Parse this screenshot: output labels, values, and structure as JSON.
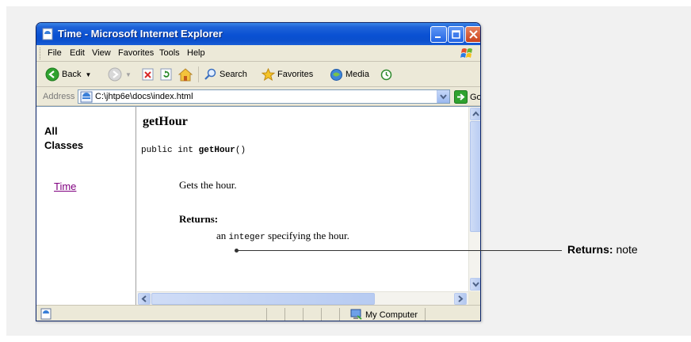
{
  "window": {
    "title": "Time - Microsoft Internet Explorer"
  },
  "menu": [
    "File",
    "Edit",
    "View",
    "Favorites",
    "Tools",
    "Help"
  ],
  "toolbar": {
    "back_label": "Back",
    "search_label": "Search",
    "favorites_label": "Favorites",
    "media_label": "Media"
  },
  "address": {
    "label": "Address",
    "value": "C:\\jhtp6e\\docs\\index.html",
    "go_label": "Go"
  },
  "nav_frame": {
    "heading_line1": "All",
    "heading_line2": "Classes",
    "link": "Time"
  },
  "main_frame": {
    "method_title": "getHour",
    "signature_prefix": "public int ",
    "signature_method": "getHour",
    "signature_suffix": "()",
    "description": "Gets the hour.",
    "returns_label": "Returns:",
    "returns_pre": "an ",
    "returns_code": "integer",
    "returns_post": " specifying the hour."
  },
  "status": {
    "zone": "My Computer"
  },
  "callout": {
    "bold": "Returns:",
    "text": " note"
  },
  "colors": {
    "titlebar": "#0a51d3",
    "visited_link": "#800080",
    "chrome": "#ece9d8"
  }
}
